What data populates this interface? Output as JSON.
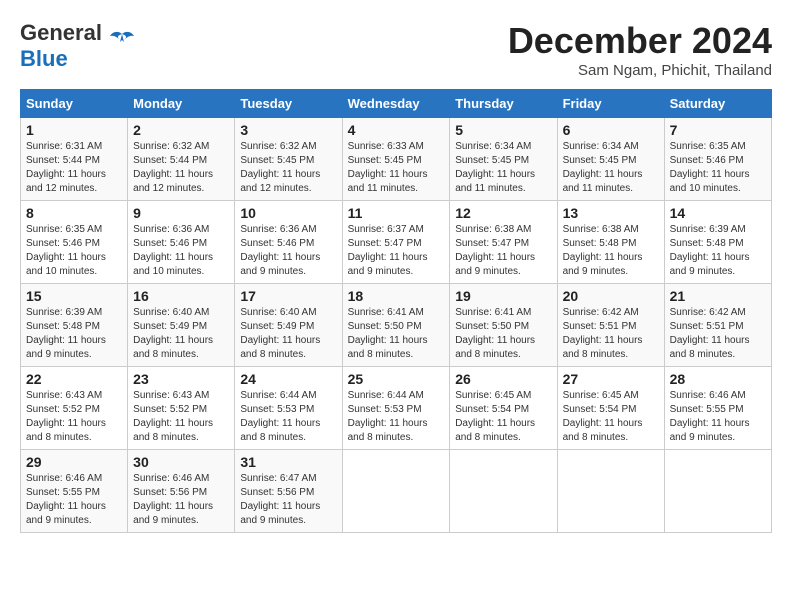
{
  "header": {
    "logo_line1": "General",
    "logo_line2": "Blue",
    "month_title": "December 2024",
    "location": "Sam Ngam, Phichit, Thailand"
  },
  "calendar": {
    "days_of_week": [
      "Sunday",
      "Monday",
      "Tuesday",
      "Wednesday",
      "Thursday",
      "Friday",
      "Saturday"
    ],
    "weeks": [
      [
        {
          "day": "1",
          "info": "Sunrise: 6:31 AM\nSunset: 5:44 PM\nDaylight: 11 hours\nand 12 minutes."
        },
        {
          "day": "2",
          "info": "Sunrise: 6:32 AM\nSunset: 5:44 PM\nDaylight: 11 hours\nand 12 minutes."
        },
        {
          "day": "3",
          "info": "Sunrise: 6:32 AM\nSunset: 5:45 PM\nDaylight: 11 hours\nand 12 minutes."
        },
        {
          "day": "4",
          "info": "Sunrise: 6:33 AM\nSunset: 5:45 PM\nDaylight: 11 hours\nand 11 minutes."
        },
        {
          "day": "5",
          "info": "Sunrise: 6:34 AM\nSunset: 5:45 PM\nDaylight: 11 hours\nand 11 minutes."
        },
        {
          "day": "6",
          "info": "Sunrise: 6:34 AM\nSunset: 5:45 PM\nDaylight: 11 hours\nand 11 minutes."
        },
        {
          "day": "7",
          "info": "Sunrise: 6:35 AM\nSunset: 5:46 PM\nDaylight: 11 hours\nand 10 minutes."
        }
      ],
      [
        {
          "day": "8",
          "info": "Sunrise: 6:35 AM\nSunset: 5:46 PM\nDaylight: 11 hours\nand 10 minutes."
        },
        {
          "day": "9",
          "info": "Sunrise: 6:36 AM\nSunset: 5:46 PM\nDaylight: 11 hours\nand 10 minutes."
        },
        {
          "day": "10",
          "info": "Sunrise: 6:36 AM\nSunset: 5:46 PM\nDaylight: 11 hours\nand 9 minutes."
        },
        {
          "day": "11",
          "info": "Sunrise: 6:37 AM\nSunset: 5:47 PM\nDaylight: 11 hours\nand 9 minutes."
        },
        {
          "day": "12",
          "info": "Sunrise: 6:38 AM\nSunset: 5:47 PM\nDaylight: 11 hours\nand 9 minutes."
        },
        {
          "day": "13",
          "info": "Sunrise: 6:38 AM\nSunset: 5:48 PM\nDaylight: 11 hours\nand 9 minutes."
        },
        {
          "day": "14",
          "info": "Sunrise: 6:39 AM\nSunset: 5:48 PM\nDaylight: 11 hours\nand 9 minutes."
        }
      ],
      [
        {
          "day": "15",
          "info": "Sunrise: 6:39 AM\nSunset: 5:48 PM\nDaylight: 11 hours\nand 9 minutes."
        },
        {
          "day": "16",
          "info": "Sunrise: 6:40 AM\nSunset: 5:49 PM\nDaylight: 11 hours\nand 8 minutes."
        },
        {
          "day": "17",
          "info": "Sunrise: 6:40 AM\nSunset: 5:49 PM\nDaylight: 11 hours\nand 8 minutes."
        },
        {
          "day": "18",
          "info": "Sunrise: 6:41 AM\nSunset: 5:50 PM\nDaylight: 11 hours\nand 8 minutes."
        },
        {
          "day": "19",
          "info": "Sunrise: 6:41 AM\nSunset: 5:50 PM\nDaylight: 11 hours\nand 8 minutes."
        },
        {
          "day": "20",
          "info": "Sunrise: 6:42 AM\nSunset: 5:51 PM\nDaylight: 11 hours\nand 8 minutes."
        },
        {
          "day": "21",
          "info": "Sunrise: 6:42 AM\nSunset: 5:51 PM\nDaylight: 11 hours\nand 8 minutes."
        }
      ],
      [
        {
          "day": "22",
          "info": "Sunrise: 6:43 AM\nSunset: 5:52 PM\nDaylight: 11 hours\nand 8 minutes."
        },
        {
          "day": "23",
          "info": "Sunrise: 6:43 AM\nSunset: 5:52 PM\nDaylight: 11 hours\nand 8 minutes."
        },
        {
          "day": "24",
          "info": "Sunrise: 6:44 AM\nSunset: 5:53 PM\nDaylight: 11 hours\nand 8 minutes."
        },
        {
          "day": "25",
          "info": "Sunrise: 6:44 AM\nSunset: 5:53 PM\nDaylight: 11 hours\nand 8 minutes."
        },
        {
          "day": "26",
          "info": "Sunrise: 6:45 AM\nSunset: 5:54 PM\nDaylight: 11 hours\nand 8 minutes."
        },
        {
          "day": "27",
          "info": "Sunrise: 6:45 AM\nSunset: 5:54 PM\nDaylight: 11 hours\nand 8 minutes."
        },
        {
          "day": "28",
          "info": "Sunrise: 6:46 AM\nSunset: 5:55 PM\nDaylight: 11 hours\nand 9 minutes."
        }
      ],
      [
        {
          "day": "29",
          "info": "Sunrise: 6:46 AM\nSunset: 5:55 PM\nDaylight: 11 hours\nand 9 minutes."
        },
        {
          "day": "30",
          "info": "Sunrise: 6:46 AM\nSunset: 5:56 PM\nDaylight: 11 hours\nand 9 minutes."
        },
        {
          "day": "31",
          "info": "Sunrise: 6:47 AM\nSunset: 5:56 PM\nDaylight: 11 hours\nand 9 minutes."
        },
        null,
        null,
        null,
        null
      ]
    ]
  }
}
